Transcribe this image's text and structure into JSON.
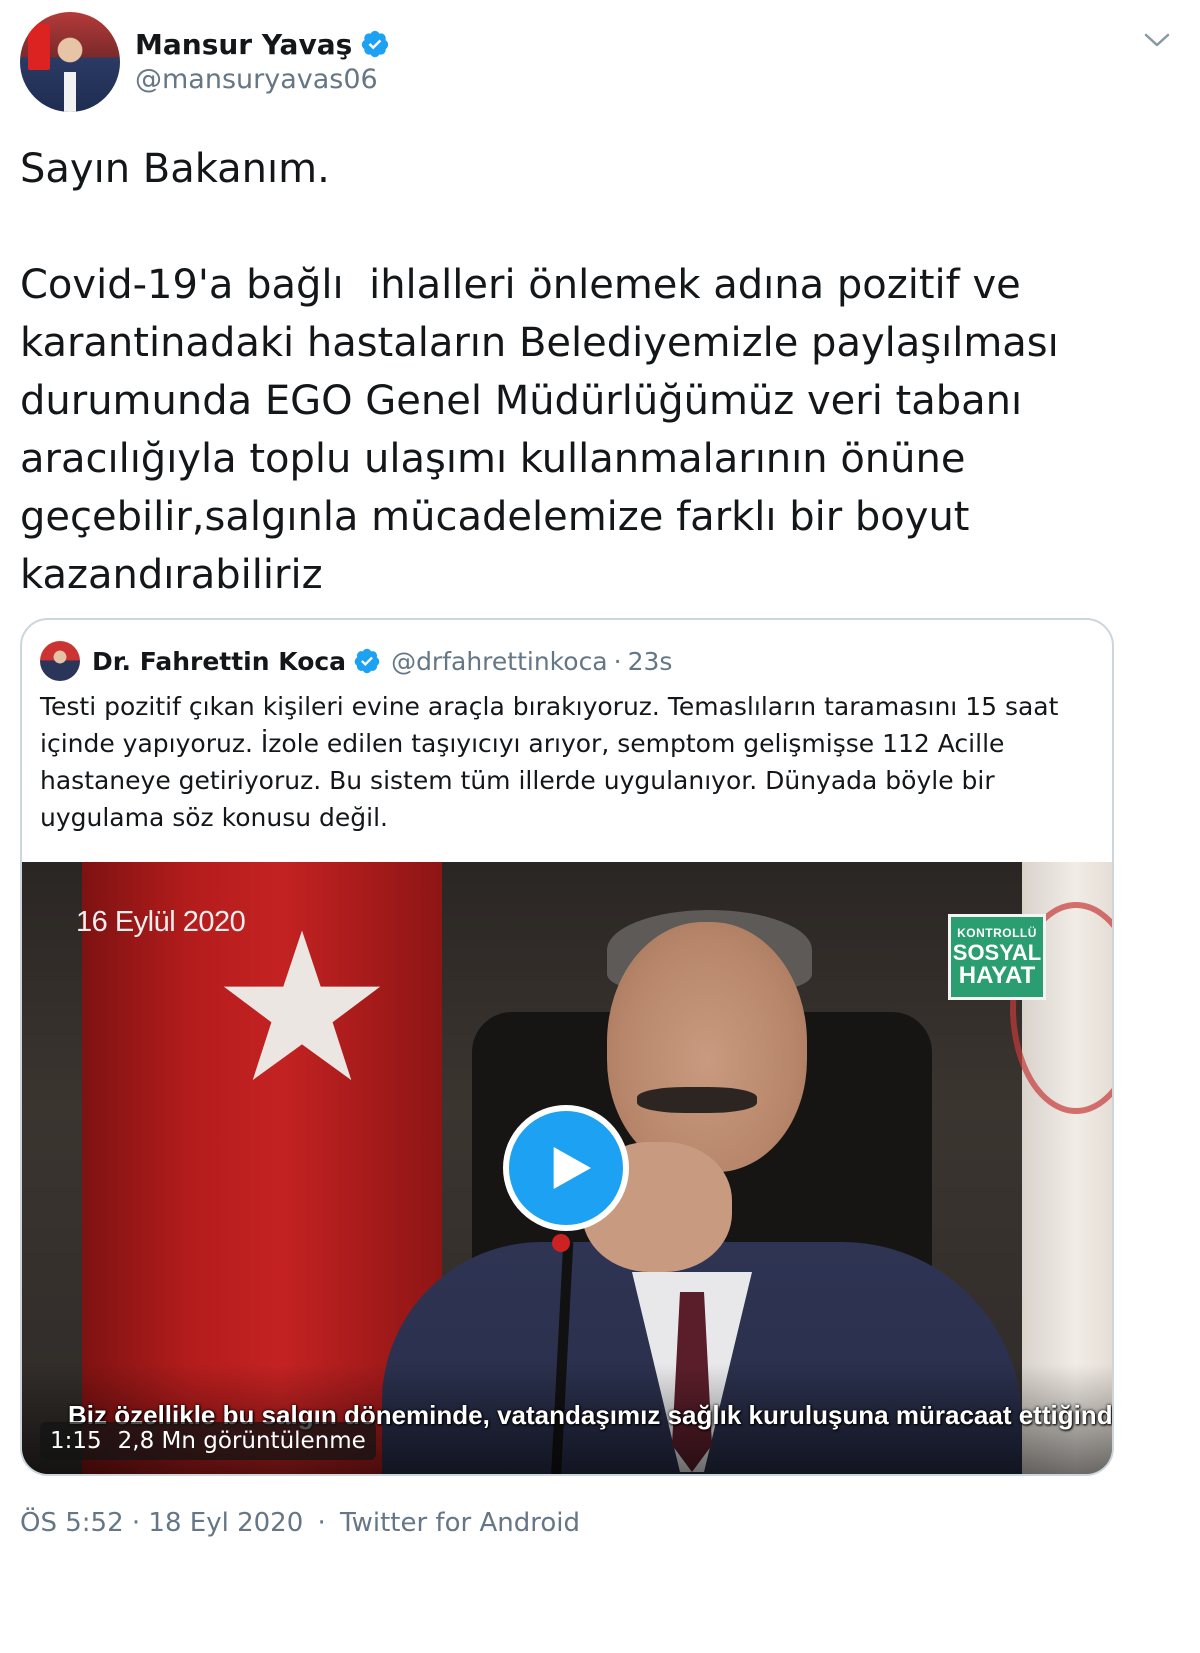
{
  "tweet": {
    "author": {
      "name": "Mansur Yavaş",
      "handle": "@mansuryavas06"
    },
    "text": "Sayın Bakanım.\n\nCovid-19'a bağlı  ihlalleri önlemek adına pozitif ve karantinadaki hastaların Belediyemizle paylaşılması durumunda EGO Genel Müdürlüğümüz veri tabanı aracılığıyla toplu ulaşımı kullanmalarının önüne geçebilir,salgınla mücadelemize farklı bir boyut kazandırabiliriz",
    "timestamp": "ÖS 5:52 · 18 Eyl 2020",
    "source_separator": "·",
    "source": "Twitter for Android"
  },
  "quoted_tweet": {
    "author": {
      "name": "Dr. Fahrettin Koca",
      "handle": "@drfahrettinkoca"
    },
    "separator": "·",
    "time": "23s",
    "text": "Testi pozitif çıkan kişileri evine araçla bırakıyoruz. Temaslıların taramasını 15 saat içinde yapıyoruz. İzole edilen taşıyıcıyı arıyor, semptom gelişmişse 112 Acille hastaneye getiriyoruz. Bu sistem tüm illerde uygulanıyor. Dünyada böyle bir uygulama söz konusu değil.",
    "video": {
      "date_overlay": "16 Eylül 2020",
      "badge": {
        "line1": "KONTROLLÜ",
        "line2": "SOSYAL",
        "line3": "HAYAT"
      },
      "subtitle": "Biz özellikle bu salgın döneminde, vatandaşımız sağlık kuruluşuna müracaat ettiğinde;",
      "duration": "1:15",
      "views": "2,8 Mn görüntülenme"
    }
  },
  "colors": {
    "accent": "#1da1f2",
    "secondary_text": "#657786",
    "badge_green": "#2b9e71"
  },
  "icons": {
    "verified": "verified-badge-icon",
    "caret": "chevron-down-icon",
    "play": "play-icon"
  }
}
